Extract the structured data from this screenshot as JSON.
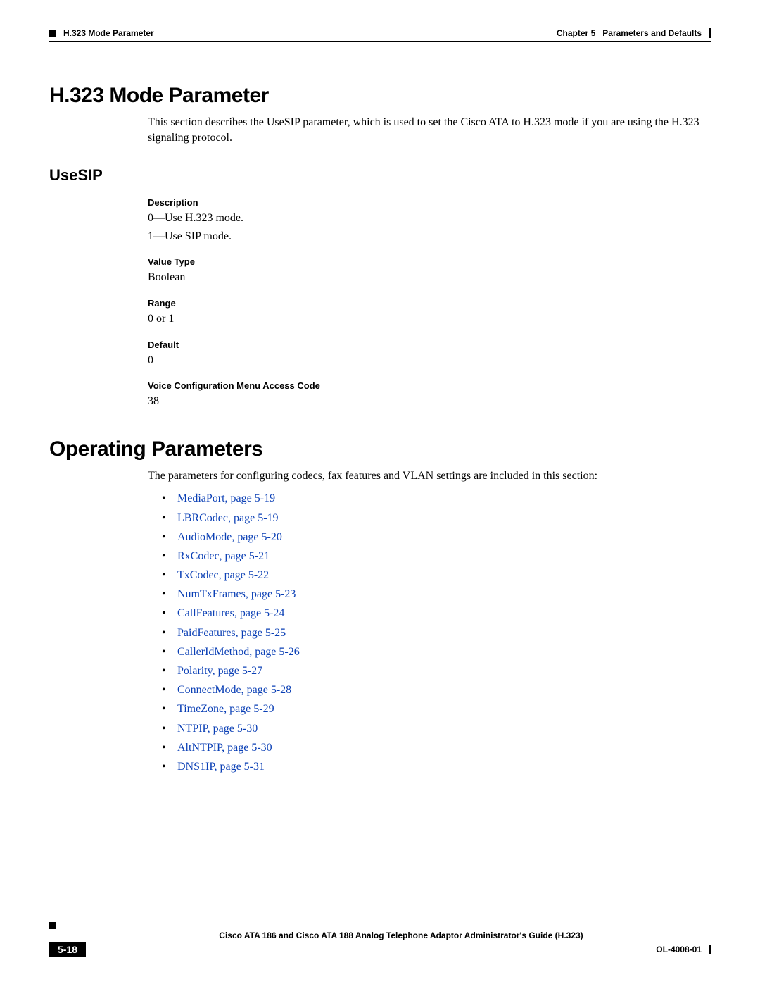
{
  "header": {
    "left": "H.323 Mode Parameter",
    "right_chapter": "Chapter 5",
    "right_title": "Parameters and Defaults"
  },
  "section1": {
    "title": "H.323 Mode Parameter",
    "intro": "This section describes the UseSIP parameter, which is used to set the Cisco ATA to H.323 mode if you are using the H.323 signaling protocol.",
    "sub_title": "UseSIP",
    "desc_label": "Description",
    "desc_line1": "0—Use H.323 mode.",
    "desc_line2": "1—Use SIP mode.",
    "vt_label": "Value Type",
    "vt_value": "Boolean",
    "range_label": "Range",
    "range_value": "0 or 1",
    "default_label": "Default",
    "default_value": "0",
    "vcm_label": "Voice Configuration Menu Access Code",
    "vcm_value": "38"
  },
  "section2": {
    "title": "Operating Parameters",
    "intro": "The parameters for configuring codecs, fax features and VLAN settings are included in this section:",
    "links": [
      "MediaPort, page 5-19",
      "LBRCodec, page 5-19",
      "AudioMode, page 5-20",
      "RxCodec, page 5-21",
      "TxCodec, page 5-22",
      "NumTxFrames, page 5-23",
      "CallFeatures, page 5-24",
      "PaidFeatures, page 5-25",
      "CallerIdMethod, page 5-26",
      "Polarity, page 5-27",
      "ConnectMode, page 5-28",
      "TimeZone, page 5-29",
      "NTPIP, page 5-30",
      "AltNTPIP, page 5-30",
      "DNS1IP, page 5-31"
    ]
  },
  "footer": {
    "guide": "Cisco ATA 186 and Cisco ATA 188 Analog Telephone Adaptor Administrator's Guide (H.323)",
    "page": "5-18",
    "doc_code": "OL-4008-01"
  }
}
